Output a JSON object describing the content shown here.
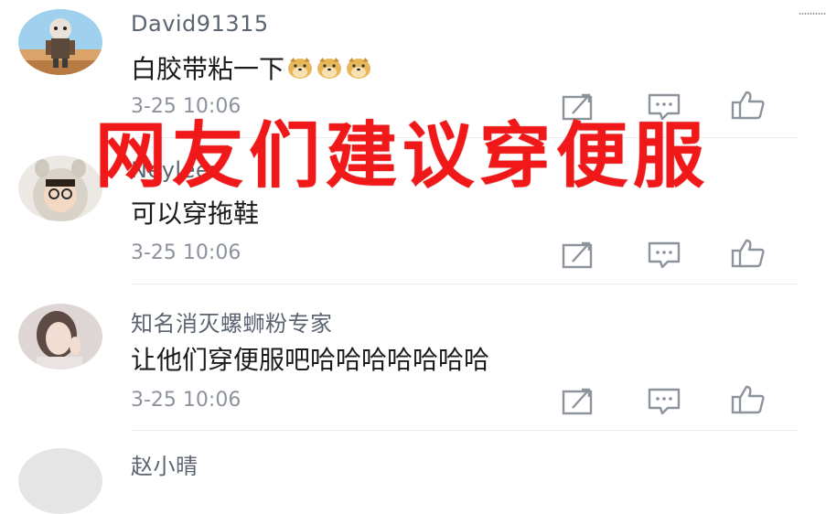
{
  "overlay": {
    "title": "网友们建议穿便服"
  },
  "comments": [
    {
      "username": "David91315",
      "text": "白胶带粘一下",
      "emoji": "doge-emoji",
      "time": "3-25 10:06"
    },
    {
      "username": "Neyleer",
      "text": "可以穿拖鞋",
      "time": "3-25 10:06"
    },
    {
      "username": "知名消灭螺蛳粉专家",
      "text": "让他们穿便服吧哈哈哈哈哈哈哈",
      "time": "3-25 10:06"
    },
    {
      "username": "赵小晴"
    }
  ],
  "colors": {
    "overlay": "#f01818",
    "username": "#5b6470",
    "text": "#1b1b1b",
    "meta": "#8c939c"
  }
}
